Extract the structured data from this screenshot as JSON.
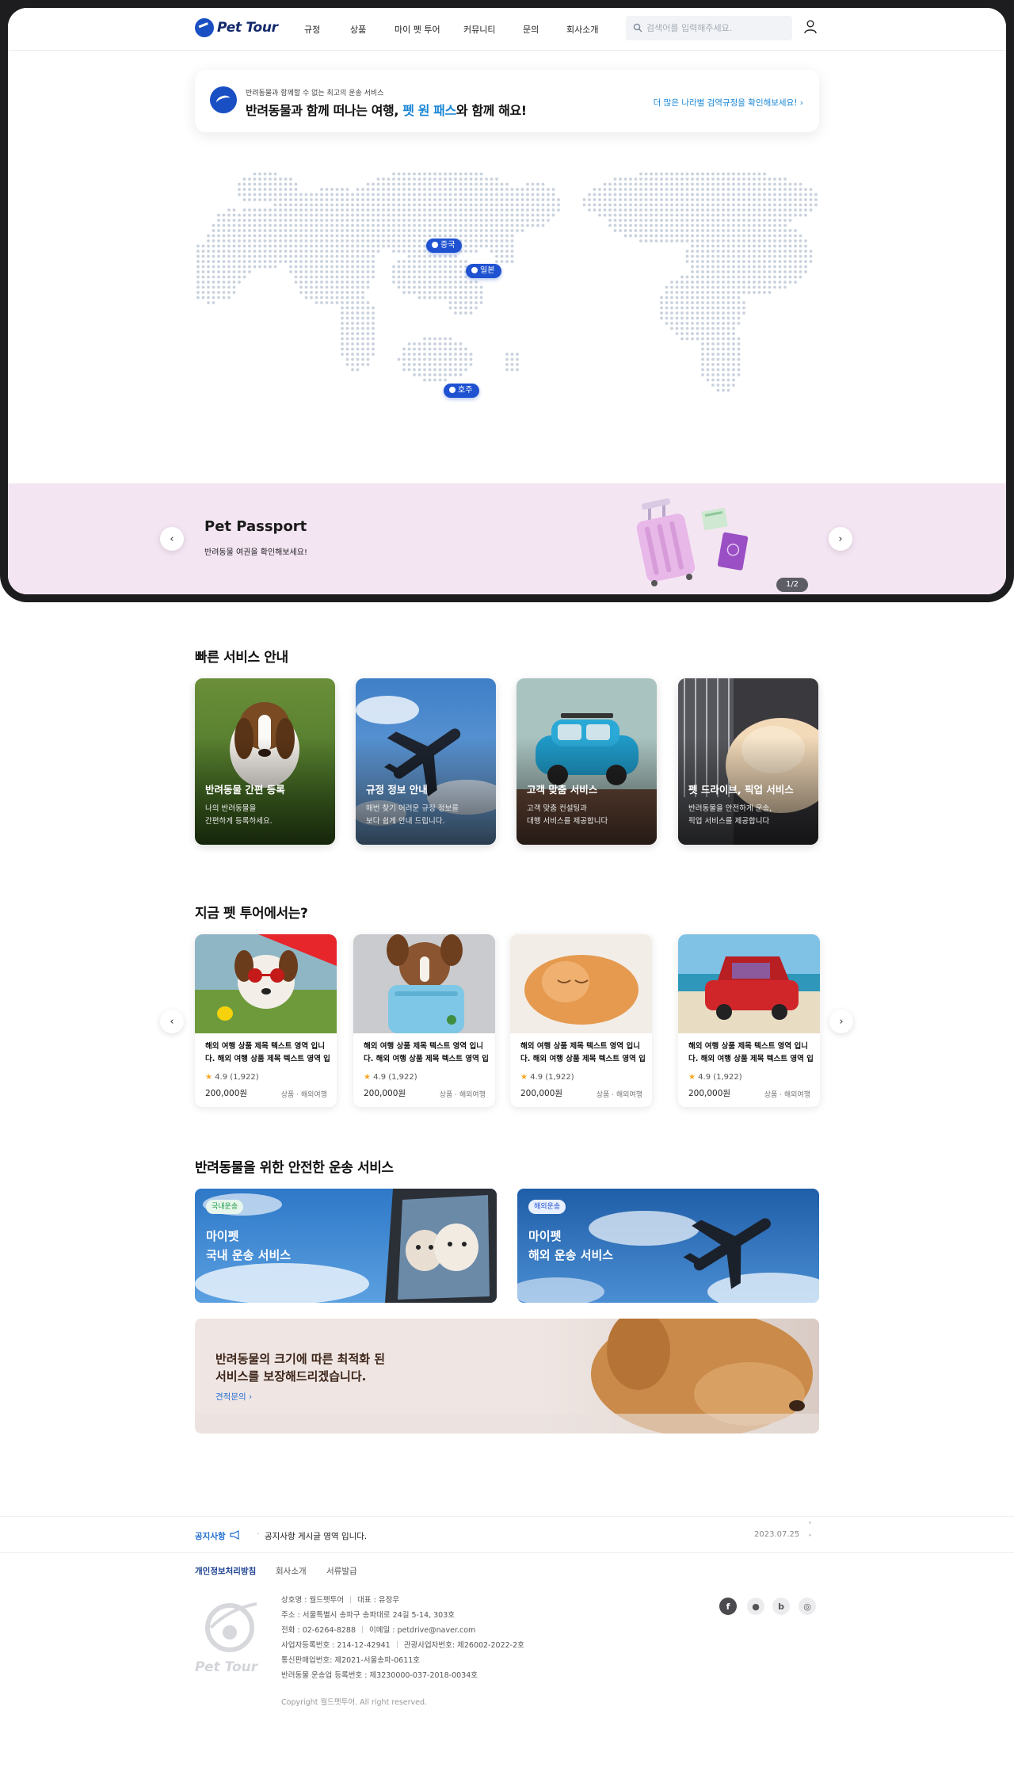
{
  "nav": {
    "logo_text": "Pet Tour",
    "menu": [
      "규정",
      "상품",
      "마이 펫 투어",
      "커뮤니티",
      "문의",
      "회사소개"
    ],
    "search_placeholder": "검색어를 입력해주세요."
  },
  "intro": {
    "subtitle": "반려동물과 함께할 수 없는 최고의 운송 서비스",
    "headline_prefix": "반려동물과 함께 떠나는 여행, ",
    "headline_highlight": "펫 원 패스",
    "headline_suffix": "와 함께 해요!",
    "link": "더 많은 나라별 검역규정을 확인해보세요! ›"
  },
  "map": {
    "pins": [
      "중국",
      "일본",
      "호주"
    ],
    "pin_color": "#1f52d0"
  },
  "hero": {
    "title": "Pet Passport",
    "desc": "반려동물 여권을 확인해보세요!",
    "pager": "1/2",
    "bg_color": "#f4e5f3"
  },
  "quick_services": {
    "title": "빠른 서비스 안내",
    "items": [
      {
        "title": "반려동물 간편 등록",
        "line1": "나의 반려동물을",
        "line2": "간편하게 등록하세요."
      },
      {
        "title": "규정 정보 안내",
        "line1": "매번 찾기 어려운 규정 정보를",
        "line2": "보다 쉽게 안내 드립니다."
      },
      {
        "title": "고객 맞춤 서비스",
        "line1": "고객 맞춤 컨설팅과",
        "line2": "대행 서비스를 제공합니다"
      },
      {
        "title": "펫 드라이브, 픽업 서비스",
        "line1": "반려동물을 안전하게 운송,",
        "line2": "픽업 서비스를 제공합니다"
      }
    ]
  },
  "now": {
    "title": "지금 펫 투어에서는?",
    "products": [
      {
        "title": "해외 여행 상품 제목 텍스트 영역 입니다. 해외 여행 상품 제목 텍스트 영역 입니다.",
        "rating": "4.9 (1,922)",
        "price": "200,000원",
        "tag": "상품 · 해외여행"
      },
      {
        "title": "해외 여행 상품 제목 텍스트 영역 입니다. 해외 여행 상품 제목 텍스트 영역 입니다.",
        "rating": "4.9 (1,922)",
        "price": "200,000원",
        "tag": "상품 · 해외여행"
      },
      {
        "title": "해외 여행 상품 제목 텍스트 영역 입니다. 해외 여행 상품 제목 텍스트 영역 입니다.",
        "rating": "4.9 (1,922)",
        "price": "200,000원",
        "tag": "상품 · 해외여행"
      },
      {
        "title": "해외 여행 상품 제목 텍스트 영역 입니다. 해외 여행 상품 제목 텍스트 영역 입니다.",
        "rating": "4.9 (1,922)",
        "price": "200,000원",
        "tag": "상품 · 해외여행"
      }
    ]
  },
  "transport": {
    "title": "반려동물을 위한 안전한 운송 서비스",
    "domestic": {
      "badge": "국내운송",
      "line1": "마이펫",
      "line2": "국내 운송 서비스"
    },
    "overseas": {
      "badge": "해외운송",
      "line1": "마이펫",
      "line2": "해외 운송 서비스"
    },
    "promo_line1": "반려동물의 크기에 따른 최적화 된",
    "promo_line2": "서비스를 보장해드리겠습니다.",
    "promo_link": "견적문의 ›"
  },
  "notice": {
    "label": "공지사항",
    "text": "공지사항 게시글 영역 입니다.",
    "date": "2023.07.25"
  },
  "footer": {
    "links": [
      "개인정보처리방침",
      "회사소개",
      "서류발급"
    ],
    "company": "상호명 : 월드펫투어",
    "ceo": "대표 : 유정우",
    "address": "주소 : 서울특별시 송파구 송파대로 24길 5-14, 303호",
    "phone": "전화 : 02-6264-8288",
    "email": "이메일 : petdrive@naver.com",
    "biz_no": "사업자등록번호 : 214-12-42941",
    "tour_no": "관광사업자번호: 제26002-2022-2호",
    "mail_order": "통신판매업번호: 제2021-서울송파-0611호",
    "transport_no": "반려동물 운송업 등록번호 : 제3230000-037-2018-0034호",
    "copyright": "Copyright 월드펫투어. All right reserved.",
    "logo_text": "Pet Tour"
  },
  "colors": {
    "accent": "#1f52d0",
    "link": "#1b87d6",
    "dark": "#1d1d1f"
  }
}
